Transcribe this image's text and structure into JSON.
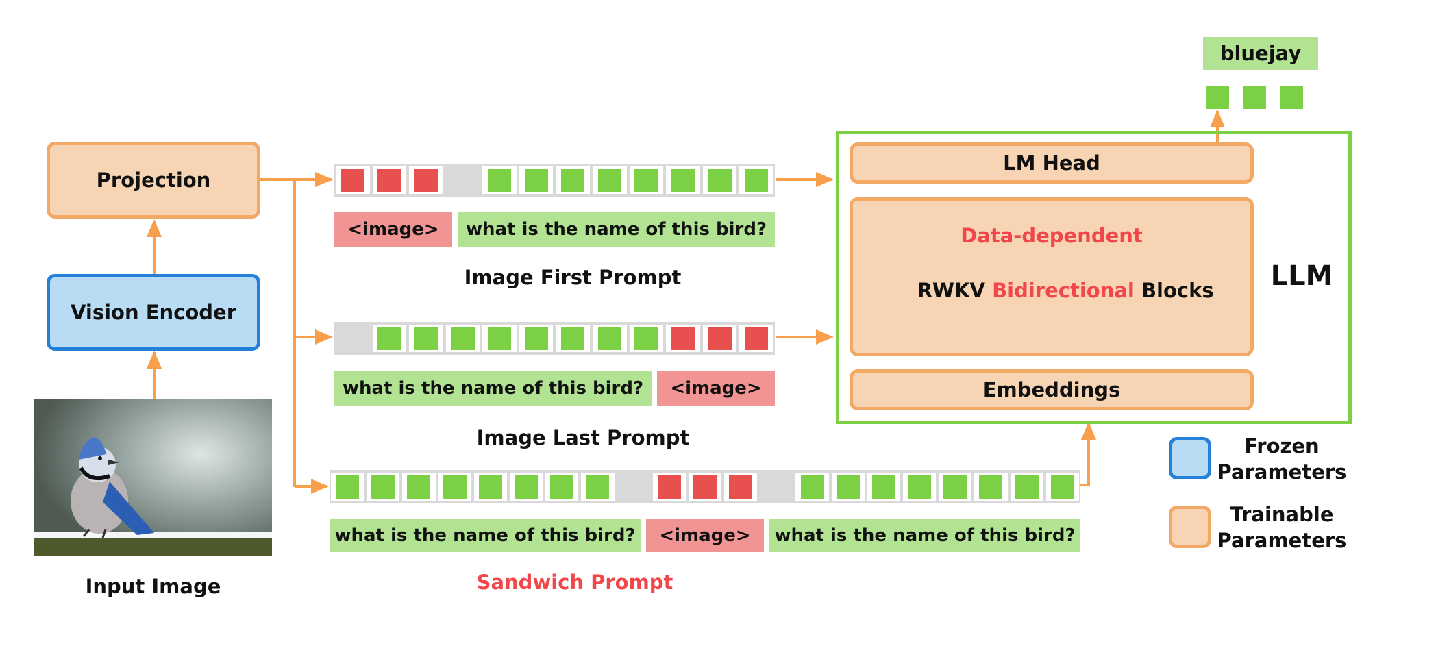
{
  "colors": {
    "trainable_fill": "#f7d5b4",
    "trainable_border": "#f2a965",
    "frozen_fill": "#b9dcf5",
    "frozen_border": "#2680d9",
    "image_token": "#e84f4f",
    "text_token": "#7bd043",
    "image_tag": "#f09494",
    "text_tag": "#b1e392",
    "arrow": "#f79f4a",
    "llm_frame": "#7bd043",
    "highlight_text": "#f2474a"
  },
  "left": {
    "projection": "Projection",
    "vision_encoder": "Vision Encoder",
    "input_image_caption": "Input Image",
    "input_image_alt": "blue jay perched on snowy branch"
  },
  "prompts": [
    {
      "caption": "Image First Prompt",
      "tokens": [
        "img",
        "img",
        "img",
        "gap",
        "txt",
        "txt",
        "txt",
        "txt",
        "txt",
        "txt",
        "txt",
        "txt"
      ],
      "segments": [
        {
          "type": "img",
          "text": "<image>"
        },
        {
          "type": "txt",
          "text": "what is the name of this bird?"
        }
      ]
    },
    {
      "caption": "Image Last Prompt",
      "tokens": [
        "gap",
        "txt",
        "txt",
        "txt",
        "txt",
        "txt",
        "txt",
        "txt",
        "txt",
        "img",
        "img",
        "img"
      ],
      "segments": [
        {
          "type": "txt",
          "text": "what is the name of this bird?"
        },
        {
          "type": "img",
          "text": "<image>"
        }
      ]
    },
    {
      "caption": "Sandwich Prompt",
      "tokens": [
        "txt",
        "txt",
        "txt",
        "txt",
        "txt",
        "txt",
        "txt",
        "txt",
        "gap",
        "img",
        "img",
        "img",
        "gap",
        "txt",
        "txt",
        "txt",
        "txt",
        "txt",
        "txt",
        "txt",
        "txt"
      ],
      "segments": [
        {
          "type": "txt",
          "text": "what is the name of this bird?"
        },
        {
          "type": "img",
          "text": "<image>"
        },
        {
          "type": "txt",
          "text": "what is the name of this bird?"
        }
      ]
    }
  ],
  "llm": {
    "label": "LLM",
    "lm_head": "LM Head",
    "blocks_line1": "Data-dependent",
    "blocks_line2_a": "RWKV ",
    "blocks_line2_b": "Bidirectional",
    "blocks_line2_c": " Blocks",
    "embeddings": "Embeddings"
  },
  "output": {
    "answer": "bluejay",
    "token_count": 3
  },
  "legend": {
    "frozen": [
      "Frozen",
      "Parameters"
    ],
    "trainable": [
      "Trainable",
      "Parameters"
    ]
  }
}
